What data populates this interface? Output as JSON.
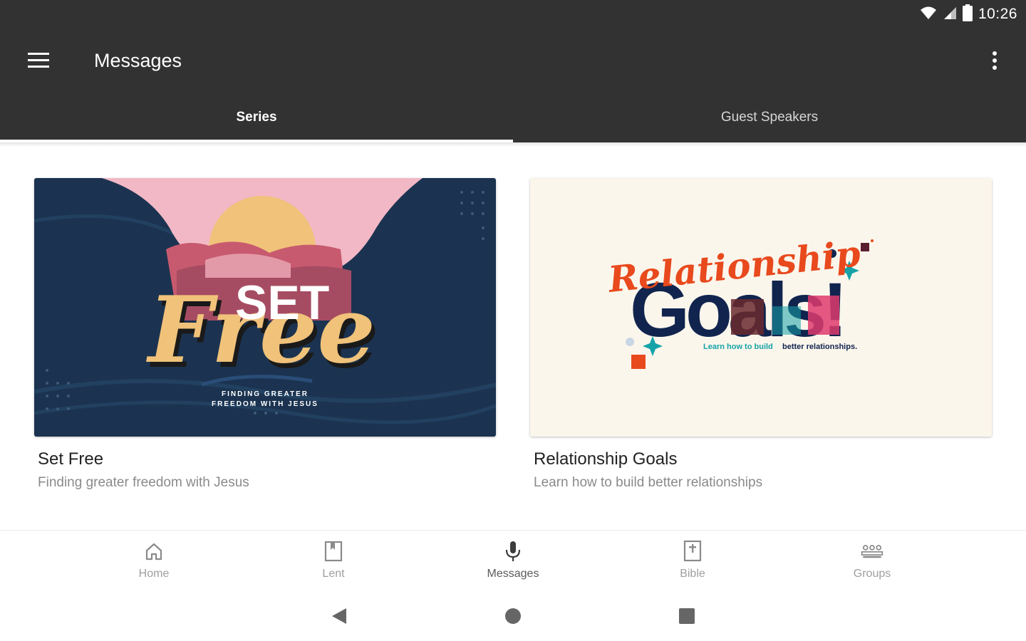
{
  "status_bar": {
    "time": "10:26",
    "icons": [
      "wifi-icon",
      "cell-signal-icon",
      "battery-icon"
    ]
  },
  "toolbar": {
    "title": "Messages",
    "menu_icon": "hamburger-menu-icon",
    "overflow_icon": "more-vert-icon"
  },
  "tabs": [
    {
      "label": "Series",
      "active": true
    },
    {
      "label": "Guest Speakers",
      "active": false
    }
  ],
  "cards": [
    {
      "title": "Set Free",
      "subtitle": "Finding greater freedom with Jesus",
      "art": {
        "word1": "SET",
        "word2": "Free",
        "tagline_line1": "FINDING GREATER",
        "tagline_line2": "FREEDOM WITH JESUS"
      }
    },
    {
      "title": "Relationship Goals",
      "subtitle": "Learn how to build better relationships",
      "art": {
        "script": "Relationship",
        "big": "Goals!",
        "tagline_a": "Learn how to build",
        "tagline_b": "better relationships."
      }
    }
  ],
  "bottom_nav": [
    {
      "label": "Home",
      "icon": "home-icon",
      "active": false
    },
    {
      "label": "Lent",
      "icon": "book-icon",
      "active": false
    },
    {
      "label": "Messages",
      "icon": "microphone-icon",
      "active": true
    },
    {
      "label": "Bible",
      "icon": "bible-icon",
      "active": false
    },
    {
      "label": "Groups",
      "icon": "groups-icon",
      "active": false
    }
  ],
  "colors": {
    "app_bar": "#323232",
    "navy": "#1b3350",
    "sun": "#f0c27a",
    "pink": "#f2b8c6",
    "cream": "#fbf6ec",
    "orange_red": "#e8491d",
    "teal": "#15a3a8",
    "magenta": "#de3b6e",
    "dark_navy": "#10244e"
  }
}
